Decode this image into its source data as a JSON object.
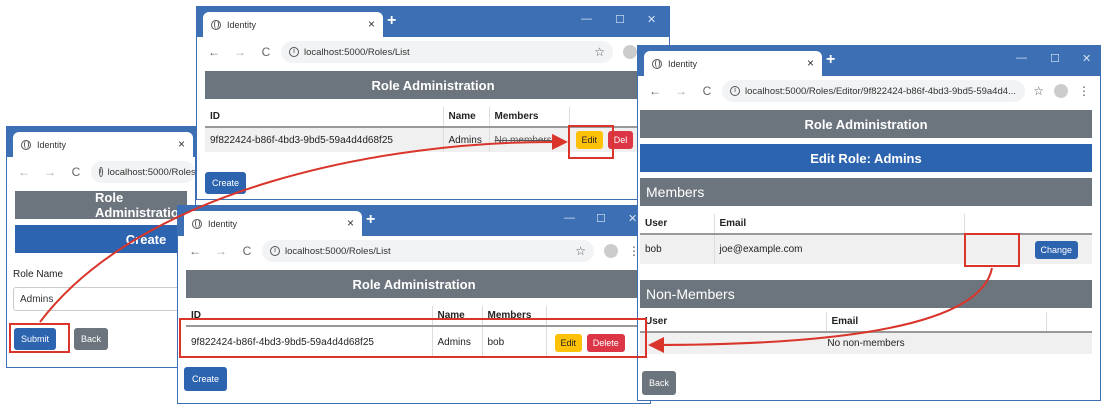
{
  "browser": {
    "tab_title": "Identity",
    "url_list": "localhost:5000/Roles/List",
    "url_create": "localhost:5000/Roles",
    "url_editor": "localhost:5000/Roles/Editor/9f822424-b86f-4bd3-9bd5-59a4d4..."
  },
  "page": {
    "header": "Role Administration",
    "create_header": "Create",
    "edit_header": "Edit Role: Admins"
  },
  "list_before": {
    "columns": [
      "ID",
      "Name",
      "Members"
    ],
    "row": {
      "id": "9f822424-b86f-4bd3-9bd5-59a4d4d68f25",
      "name": "Admins",
      "members": "No members"
    },
    "edit_label": "Edit",
    "delete_label": "Del",
    "create_label": "Create"
  },
  "list_after": {
    "columns": [
      "ID",
      "Name",
      "Members"
    ],
    "row": {
      "id": "9f822424-b86f-4bd3-9bd5-59a4d4d68f25",
      "name": "Admins",
      "members": "bob"
    },
    "edit_label": "Edit",
    "delete_label": "Delete",
    "create_label": "Create"
  },
  "create_form": {
    "label": "Role Name",
    "value": "Admins",
    "submit_label": "Submit",
    "back_label": "Back"
  },
  "editor": {
    "members_title": "Members",
    "members_columns": [
      "User",
      "Email"
    ],
    "member": {
      "user": "bob",
      "email": "joe@example.com"
    },
    "change_label": "Change",
    "nonmembers_title": "Non-Members",
    "nonmembers_columns": [
      "User",
      "Email"
    ],
    "nonmembers_empty": "No non-members",
    "back_label": "Back"
  },
  "colors": {
    "titlebar": "#3c6fb4",
    "annotation": "#d9352b",
    "primary": "#2d64b0",
    "warning": "#ffc107",
    "danger": "#dc3545",
    "secondary": "#6c757d"
  }
}
